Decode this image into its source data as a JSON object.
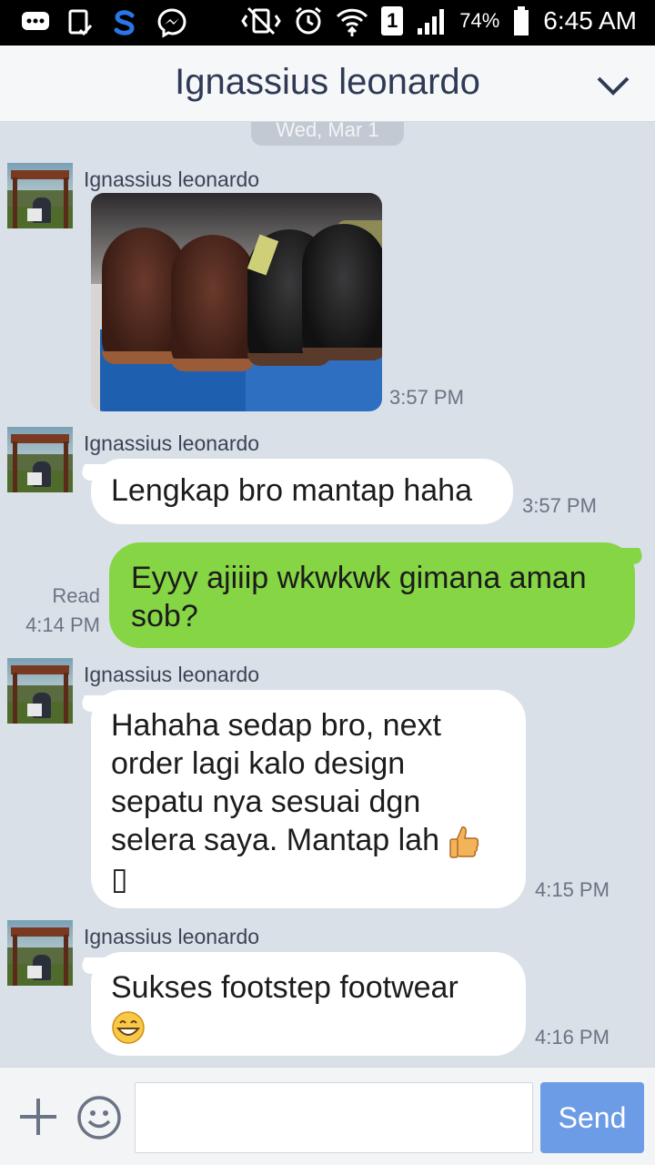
{
  "status_bar": {
    "battery_percent": "74%",
    "time": "6:45 AM",
    "sim_slot": "1",
    "icons": [
      "message-icon",
      "clipboard-check-icon",
      "s-app-icon",
      "messenger-icon",
      "mute-vibrate-icon",
      "alarm-icon",
      "wifi-icon",
      "sim-icon",
      "signal-icon",
      "battery-icon"
    ]
  },
  "header": {
    "title": "Ignassius leonardo",
    "chevron_icon": "chevron-down-icon"
  },
  "chat": {
    "date_label": "Wed, Mar 1",
    "messages": [
      {
        "sender": "Ignassius leonardo",
        "type": "image",
        "time": "3:57 PM"
      },
      {
        "sender": "Ignassius leonardo",
        "type": "text",
        "text": "Lengkap bro mantap haha",
        "time": "3:57 PM"
      },
      {
        "sender": "me",
        "type": "text",
        "text_line1": "Eyyy ajiiip wkwkwk gimana aman",
        "text_line2": "sob?",
        "read_label": "Read",
        "time": "4:14 PM"
      },
      {
        "sender": "Ignassius leonardo",
        "type": "text",
        "text_lines": [
          "Hahaha sedap bro, next",
          "order lagi kalo design",
          "sepatu nya sesuai dgn",
          "selera saya. Mantap lah",
          "▯"
        ],
        "time": "4:15 PM"
      },
      {
        "sender": "Ignassius leonardo",
        "type": "text",
        "text_line1": "Sukses footstep footwear",
        "time": "4:16 PM"
      }
    ]
  },
  "input_bar": {
    "placeholder": "",
    "send_label": "Send"
  },
  "colors": {
    "background": "#d9e0e8",
    "outgoing_bubble": "#85d544",
    "incoming_bubble": "#ffffff",
    "send_button": "#6d9ce6",
    "header_title": "#2f3a55"
  }
}
